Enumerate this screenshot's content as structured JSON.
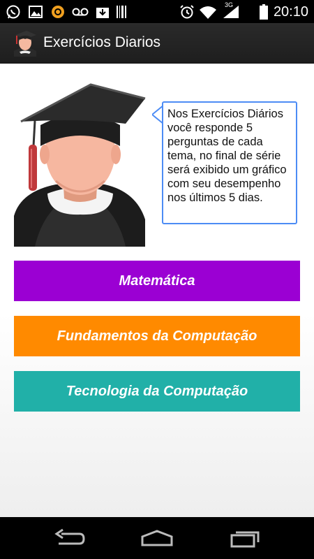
{
  "status_bar": {
    "time": "20:10",
    "network": "3G",
    "icons": [
      "whatsapp-icon",
      "image-icon",
      "record-icon",
      "voicemail-icon",
      "download-icon",
      "barcode-icon",
      "alarm-icon",
      "wifi-icon",
      "signal-icon",
      "battery-icon"
    ]
  },
  "action_bar": {
    "title": "Exercícios Diarios",
    "icon": "graduate-avatar-icon"
  },
  "intro": {
    "text": "Nos Exercícios Diários você responde 5 perguntas de cada tema, no final de série será exibido um gráfico com seu desempenho nos últimos 5 dias."
  },
  "buttons": {
    "matematica": "Matemática",
    "fundamentos": "Fundamentos da Computação",
    "tecnologia": "Tecnologia da Computação"
  },
  "colors": {
    "matematica": "#9b00d3",
    "fundamentos": "#ff8a00",
    "tecnologia": "#21b0a8",
    "bubble_border": "#4c8cf5"
  },
  "nav_bar": {
    "icons": [
      "back-icon",
      "home-icon",
      "recent-apps-icon"
    ]
  }
}
